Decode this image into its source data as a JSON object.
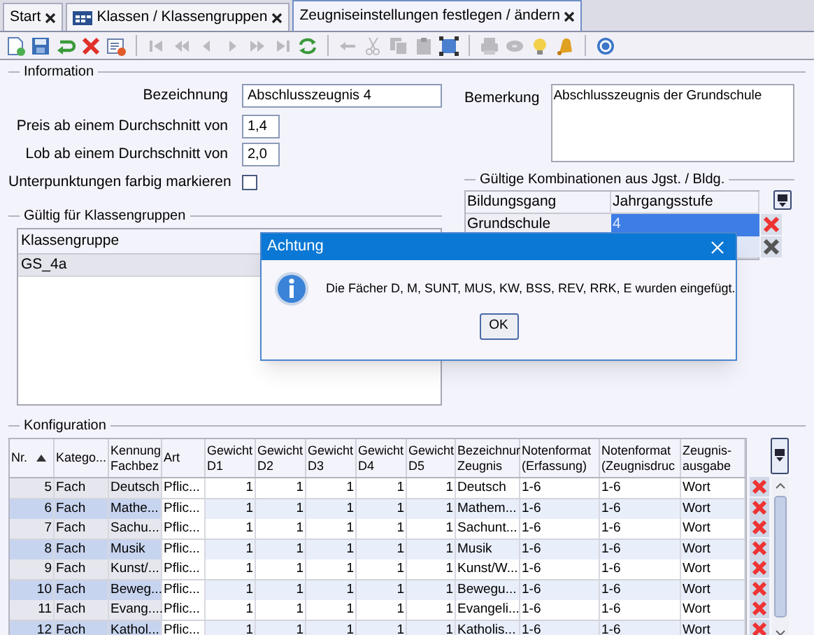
{
  "tabs": [
    {
      "label": "Start",
      "selected": false,
      "kind": "plain"
    },
    {
      "label": "Klassen / Klassengruppen",
      "selected": false,
      "kind": "table"
    },
    {
      "label": "Zeugniseinstellungen festlegen / ändern",
      "selected": true,
      "kind": "plain"
    }
  ],
  "toolbar": [
    {
      "kind": "new",
      "disabled": false
    },
    {
      "kind": "save",
      "disabled": false
    },
    {
      "kind": "undo",
      "disabled": false
    },
    {
      "kind": "delete",
      "disabled": false
    },
    {
      "kind": "export",
      "disabled": false
    },
    {
      "kind": "sep"
    },
    {
      "kind": "first",
      "disabled": true
    },
    {
      "kind": "rewind",
      "disabled": true
    },
    {
      "kind": "prev",
      "disabled": true
    },
    {
      "kind": "next",
      "disabled": true
    },
    {
      "kind": "forward",
      "disabled": true
    },
    {
      "kind": "last",
      "disabled": true
    },
    {
      "kind": "refresh",
      "disabled": false
    },
    {
      "kind": "sep"
    },
    {
      "kind": "back",
      "disabled": true
    },
    {
      "kind": "cut",
      "disabled": true
    },
    {
      "kind": "copy",
      "disabled": true
    },
    {
      "kind": "paste",
      "disabled": true
    },
    {
      "kind": "select",
      "disabled": false
    },
    {
      "kind": "sep"
    },
    {
      "kind": "print",
      "disabled": true
    },
    {
      "kind": "disk",
      "disabled": true
    },
    {
      "kind": "bulb",
      "disabled": false
    },
    {
      "kind": "bell",
      "disabled": false
    },
    {
      "kind": "sep"
    },
    {
      "kind": "help",
      "disabled": false
    }
  ],
  "information": {
    "legend": "Information",
    "fields": [
      {
        "label": "Bezeichnung",
        "value": "Abschlusszeugnis 4",
        "kind": "wide"
      },
      {
        "label": "Preis ab einem Durchschnitt von",
        "value": "1,4",
        "kind": "short"
      },
      {
        "label": "Lob ab einem Durchschnitt von",
        "value": "2,0",
        "kind": "short"
      },
      {
        "label": "Unterpunktungen farbig markieren",
        "checked": false,
        "kind": "checkbox"
      }
    ],
    "remark": {
      "label": "Bemerkung",
      "value": "Abschlusszeugnis der Grundschule"
    }
  },
  "class_groups": {
    "legend": "Gültig für Klassengruppen",
    "column": "Klassengruppe",
    "rows": [
      {
        "value": "GS_4a"
      }
    ]
  },
  "combinations": {
    "legend": "Gültige Kombinationen aus Jgst. / Bldg.",
    "columns": [
      "Bildungsgang",
      "Jahrgangsstufe"
    ],
    "rows": [
      {
        "cells": [
          "Grundschule",
          "4"
        ],
        "selected": true
      },
      {
        "selected": false
      }
    ]
  },
  "configuration": {
    "legend": "Konfiguration",
    "columns": [
      {
        "lines": [
          "Nr."
        ],
        "sorted": true
      },
      {
        "lines": [
          "Katego..."
        ]
      },
      {
        "lines": [
          "Kennung",
          "Fachbez"
        ]
      },
      {
        "lines": [
          "Art"
        ]
      },
      {
        "lines": [
          "Gewicht",
          "D1"
        ]
      },
      {
        "lines": [
          "Gewicht",
          "D2"
        ]
      },
      {
        "lines": [
          "Gewicht",
          "D3"
        ]
      },
      {
        "lines": [
          "Gewicht",
          "D4"
        ]
      },
      {
        "lines": [
          "Gewicht",
          "D5"
        ]
      },
      {
        "lines": [
          "Bezeichnur",
          "Zeugnis"
        ]
      },
      {
        "lines": [
          "Notenformat",
          "(Erfassung)"
        ]
      },
      {
        "lines": [
          "Notenformat",
          "(Zeugnisdruc"
        ]
      },
      {
        "lines": [
          "Zeugnis-",
          "ausgabe"
        ]
      }
    ],
    "rows": [
      [
        "5",
        "Fach",
        "Deutsch",
        "Pflic...",
        "1",
        "1",
        "1",
        "1",
        "1",
        "Deutsch",
        "1-6",
        "1-6",
        "Wort"
      ],
      [
        "6",
        "Fach",
        "Mathe...",
        "Pflic...",
        "1",
        "1",
        "1",
        "1",
        "1",
        "Mathem...",
        "1-6",
        "1-6",
        "Wort"
      ],
      [
        "7",
        "Fach",
        "Sachu...",
        "Pflic...",
        "1",
        "1",
        "1",
        "1",
        "1",
        "Sachunt...",
        "1-6",
        "1-6",
        "Wort"
      ],
      [
        "8",
        "Fach",
        "Musik",
        "Pflic...",
        "1",
        "1",
        "1",
        "1",
        "1",
        "Musik",
        "1-6",
        "1-6",
        "Wort"
      ],
      [
        "9",
        "Fach",
        "Kunst/...",
        "Pflic...",
        "1",
        "1",
        "1",
        "1",
        "1",
        "Kunst/W...",
        "1-6",
        "1-6",
        "Wort"
      ],
      [
        "10",
        "Fach",
        "Beweg...",
        "Pflic...",
        "1",
        "1",
        "1",
        "1",
        "1",
        "Bewegu...",
        "1-6",
        "1-6",
        "Wort"
      ],
      [
        "11",
        "Fach",
        "Evang....",
        "Pflic...",
        "1",
        "1",
        "1",
        "1",
        "1",
        "Evangeli...",
        "1-6",
        "1-6",
        "Wort"
      ],
      [
        "12",
        "Fach",
        "Kathol...",
        "Pflic...",
        "1",
        "1",
        "1",
        "1",
        "1",
        "Katholis...",
        "1-6",
        "1-6",
        "Wort"
      ]
    ]
  },
  "dialog": {
    "title": "Achtung",
    "message": "Die Fächer D, M, SUNT, MUS, KW, BSS, REV, RRK, E wurden eingefügt.",
    "button": "OK"
  }
}
